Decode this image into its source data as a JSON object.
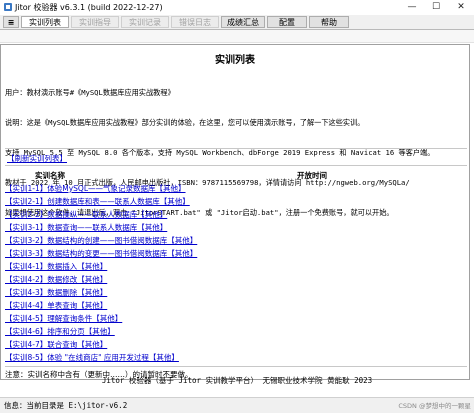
{
  "window": {
    "title": "Jitor 校验器 v6.3.1 (build 2022-12-27)",
    "minimize": "—",
    "maximize": "☐",
    "close": "✕"
  },
  "tabs": [
    {
      "label": "≡",
      "state": "menu"
    },
    {
      "label": "实训列表",
      "state": "active"
    },
    {
      "label": "实训指导",
      "state": "disabled"
    },
    {
      "label": "实训记录",
      "state": "disabled"
    },
    {
      "label": "错误日志",
      "state": "disabled"
    },
    {
      "label": "成绩汇总",
      "state": "normal"
    },
    {
      "label": "配置",
      "state": "normal"
    },
    {
      "label": "帮助",
      "state": "normal"
    }
  ],
  "panel": {
    "title": "实训列表",
    "info_lines": [
      "用户：教材演示账号#《MySQL数据库应用实战教程》",
      "说明：这是《MySQL数据库应用实战教程》部分实训的体验，在这里，您可以使用演示账号，了解一下这些实训。",
      "支持 MySQL 5.5 至 MySQL 8.0 各个版本，支持 MySQL Workbench、dbForge 2019 Express 和 Navicat 16 等客户端。",
      "教材于 2022 年 10 月正式出版，人民邮电出版社，ISBN：9787115569798，详情请访问 http://ngweb.org/MySQLa/",
      "如果想使用这个软件，请退出后，双击 \"JitorSTART.bat\" 或 \"Jitor启动.bat\"，注册一个免费账号，就可以开始。"
    ],
    "refresh_label": "【刷新实训列表】",
    "col_name": "实训名称",
    "col_time": "开放时间",
    "items": [
      "【实训1-1】体验MySQL——气象记录数据库【其他】",
      "【实训2-1】创建数据库和表——联系人数据库【其他】",
      "【实训2-2】数据操纵——联系人数据库【其他】",
      "【实训3-1】数据查询——联系人数据库【其他】",
      "【实训3-2】数据结构的创建——图书借阅数据库【其他】",
      "【实训3-3】数据结构的变更——图书借阅数据库【其他】",
      "【实训4-1】数据插入【其他】",
      "【实训4-2】数据修改【其他】",
      "【实训4-3】数据删除【其他】",
      "【实训4-4】单表查询【其他】",
      "【实训4-5】理解查询条件【其他】",
      "【实训4-6】排序和分页【其他】",
      "【实训4-7】联合查询【其他】",
      "【实训8-5】体验 \"在线商店\" 应用开发过程【其他】"
    ],
    "note": "注意：实训名称中含有（更新中……）的请暂时不要做。"
  },
  "footer": "Jitor 校验器（基于 Jitor 实训教学平台） 无锡职业技术学院 黄能耿 2023",
  "status": {
    "text": "信息：当前目录是 E:\\jitor-v6.2",
    "watermark": "CSDN @梦想中的一颗星"
  }
}
